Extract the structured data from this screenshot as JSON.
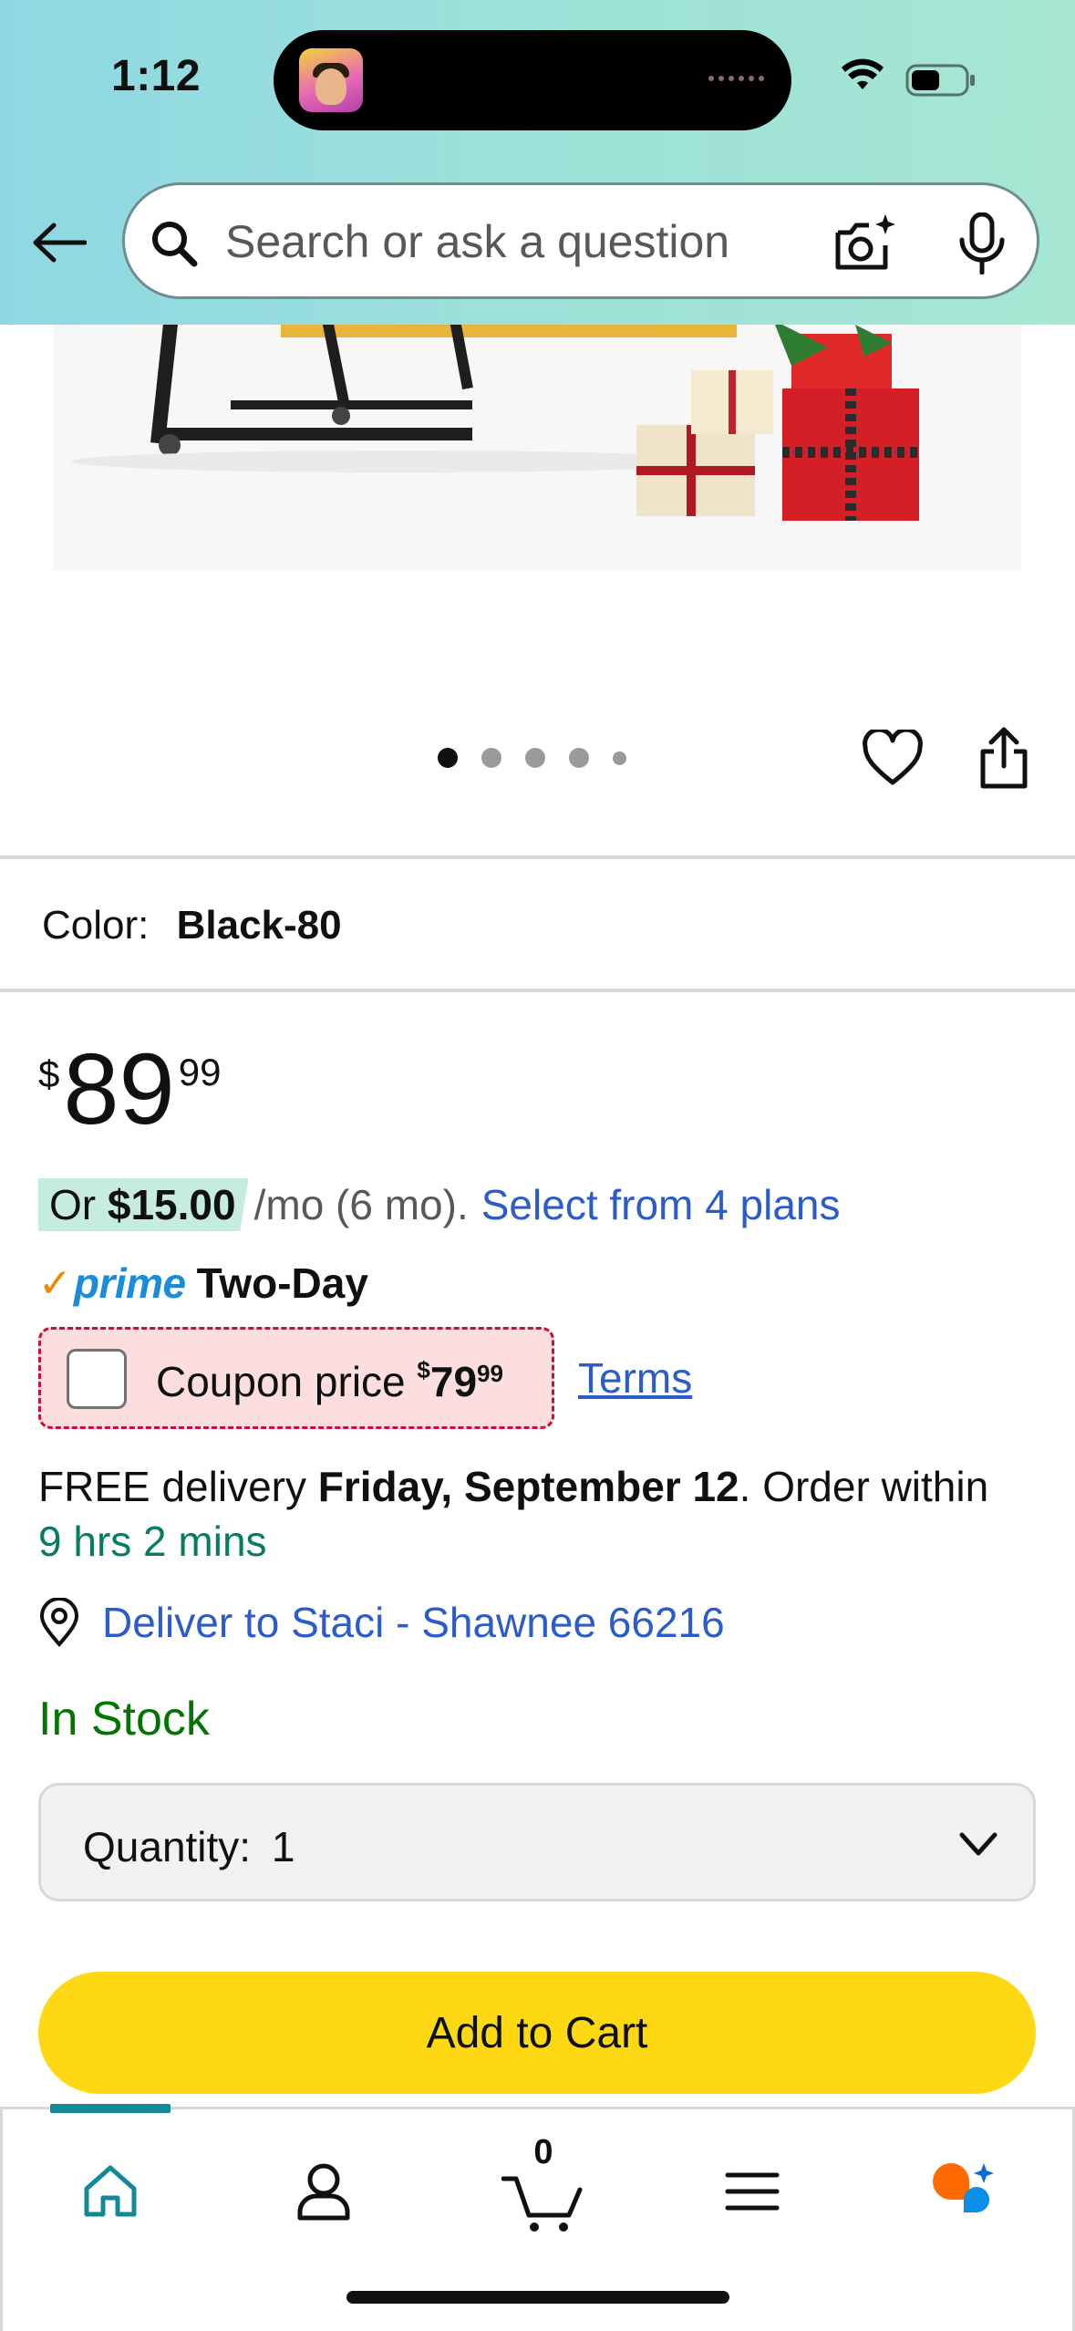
{
  "status_bar": {
    "time": "1:12"
  },
  "search": {
    "placeholder": "Search or ask a question"
  },
  "carousel": {
    "pages": 5,
    "active_index": 0
  },
  "product": {
    "color_label": "Color:",
    "color_value": "Black-80",
    "price": {
      "symbol": "$",
      "whole": "89",
      "fraction": "99"
    },
    "installment": {
      "prefix": "Or ",
      "amount": "$15.00",
      "suffix": "/mo (6 mo).",
      "link": "Select from 4 plans"
    },
    "prime": {
      "check": "✓",
      "word": "prime",
      "speed": "Two-Day"
    },
    "coupon": {
      "label": "Coupon price",
      "symbol": "$",
      "whole": "79",
      "fraction": "99",
      "terms": "Terms"
    },
    "delivery": {
      "prefix": "FREE delivery ",
      "date": "Friday, September 12",
      "middle": ". Order within",
      "timer": "9 hrs 2 mins"
    },
    "deliver_to": "Deliver to Staci - Shawnee 66216",
    "stock": "In Stock",
    "quantity": {
      "label": "Quantity:",
      "value": "1"
    },
    "add_to_cart": "Add to Cart"
  },
  "bottom_nav": {
    "cart_count": "0",
    "items": [
      "home-icon",
      "account-icon",
      "cart-icon",
      "menu-icon",
      "rufus-icon"
    ]
  },
  "colors": {
    "header_gradient_start": "#8fd8e3",
    "header_gradient_end": "#a6e6d2",
    "link": "#2b5cc9",
    "in_stock": "#007600",
    "timer": "#067d62",
    "add_to_cart": "#ffd814",
    "coupon_bg": "#fddede",
    "coupon_border": "#cc0c39",
    "nav_indicator": "#138896"
  }
}
